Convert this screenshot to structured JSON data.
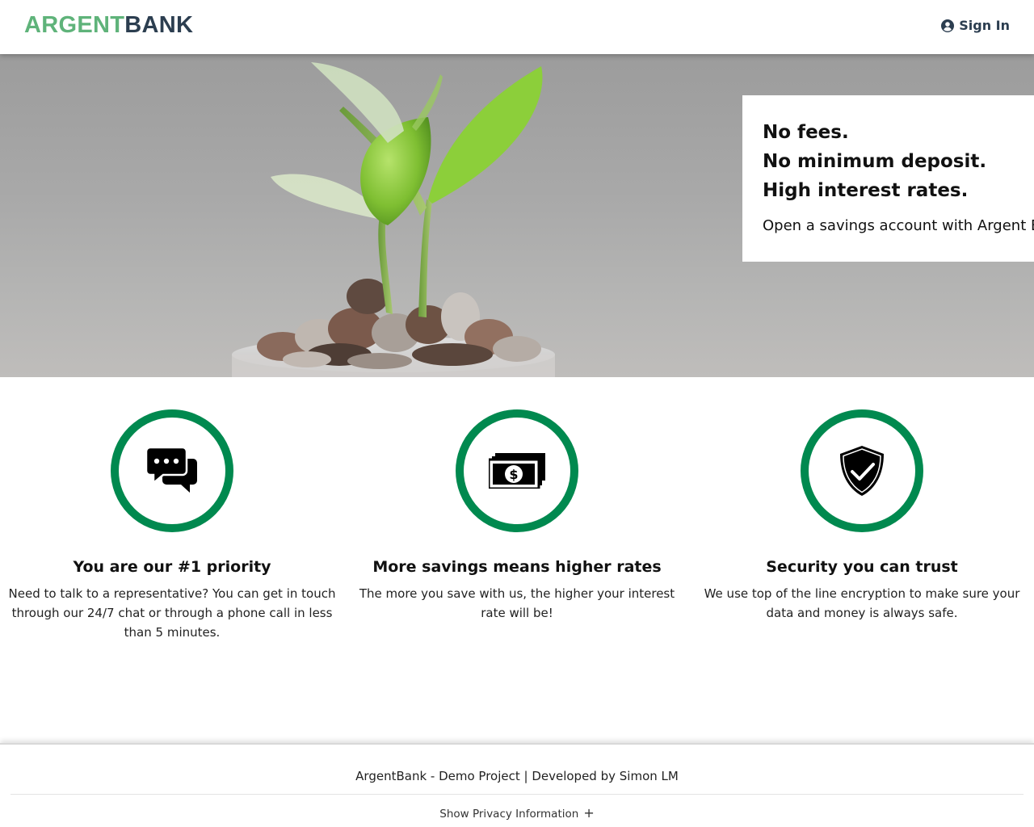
{
  "nav": {
    "logo_part1": "ARGENT",
    "logo_part2": "BANK",
    "signin_label": "Sign In",
    "signin_icon": "user-circle-icon"
  },
  "hero": {
    "lines": [
      "No fees.",
      "No minimum deposit.",
      "High interest rates."
    ],
    "subtitle": "Open a savings account with Argent Bank today!",
    "image": "plant-growing-from-coins-image"
  },
  "features": [
    {
      "icon": "chat-bubbles-icon",
      "title": "You are our #1 priority",
      "text": "Need to talk to a representative? You can get in touch through our 24/7 chat or through a phone call in less than 5 minutes."
    },
    {
      "icon": "money-bills-icon",
      "title": "More savings means higher rates",
      "text": "The more you save with us, the higher your interest rate will be!"
    },
    {
      "icon": "shield-check-icon",
      "title": "Security you can trust",
      "text": "We use top of the line encryption to make sure your data and money is always safe."
    }
  ],
  "footer": {
    "credit": "ArgentBank - Demo Project | Developed by Simon LM",
    "privacy_label": "Show Privacy Information",
    "privacy_symbol": "+"
  },
  "colors": {
    "accent_green": "#00894f",
    "logo_green": "#5fb37a",
    "logo_dark": "#2c3e50"
  }
}
